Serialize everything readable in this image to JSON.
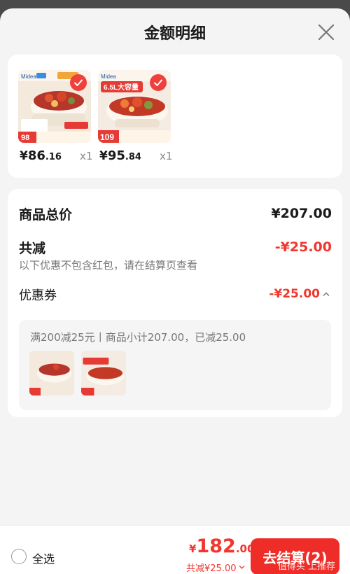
{
  "sheet": {
    "title": "金额明细"
  },
  "products": [
    {
      "currency": "¥",
      "price_int": "86",
      "price_dec": ".16",
      "qty": "x1",
      "promo_tag": "98"
    },
    {
      "currency": "¥",
      "price_int": "95",
      "price_dec": ".84",
      "qty": "x1",
      "promo_tag": "109",
      "banner_text": "6.5L大容量"
    }
  ],
  "brand_logo": "Midea",
  "summary": {
    "total_label": "商品总价",
    "total_value": "¥207.00",
    "discount_label": "共减",
    "discount_value": "-¥25.00",
    "note": "以下优惠不包含红包，请在结算页查看",
    "coupon_label": "优惠券",
    "coupon_value": "-¥25.00",
    "coupon_detail": "满200减25元丨商品小计207.00，已减25.00"
  },
  "bottom_bar": {
    "select_all": "全选",
    "currency": "¥",
    "total_int": "182",
    "total_dec": ".00",
    "discount_line": "共减¥25.00",
    "checkout_label": "去结算(2)",
    "watermark": "值得买 上推荐"
  },
  "colors": {
    "accent": "#f2352d",
    "checkout_button": "#ef2d28",
    "sheet_bg": "#f4f4f4"
  },
  "icons": [
    "close-icon",
    "check-icon",
    "chevron-up-icon",
    "chevron-down-icon"
  ]
}
